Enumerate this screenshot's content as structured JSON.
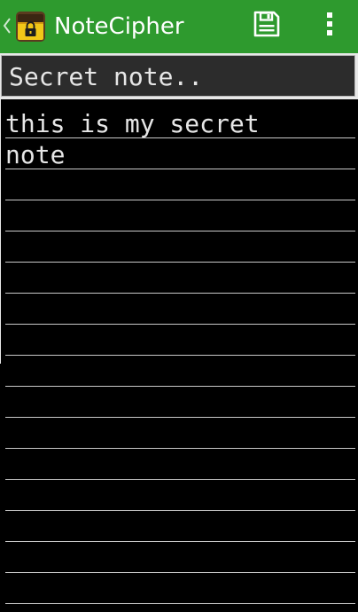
{
  "action_bar": {
    "title": "NoteCipher",
    "background_color": "#2e9a2e",
    "back_icon": "chevron-left-icon",
    "app_icon": "lock-chest-icon",
    "save_icon": "floppy-disk-icon",
    "overflow_icon": "vertical-ellipsis-icon"
  },
  "editor": {
    "title_value": "Secret note..",
    "body_value": "this is my secret\nnote",
    "background_color": "#000000",
    "text_color": "#e6e6e6",
    "line_color": "#c9c9c9"
  }
}
